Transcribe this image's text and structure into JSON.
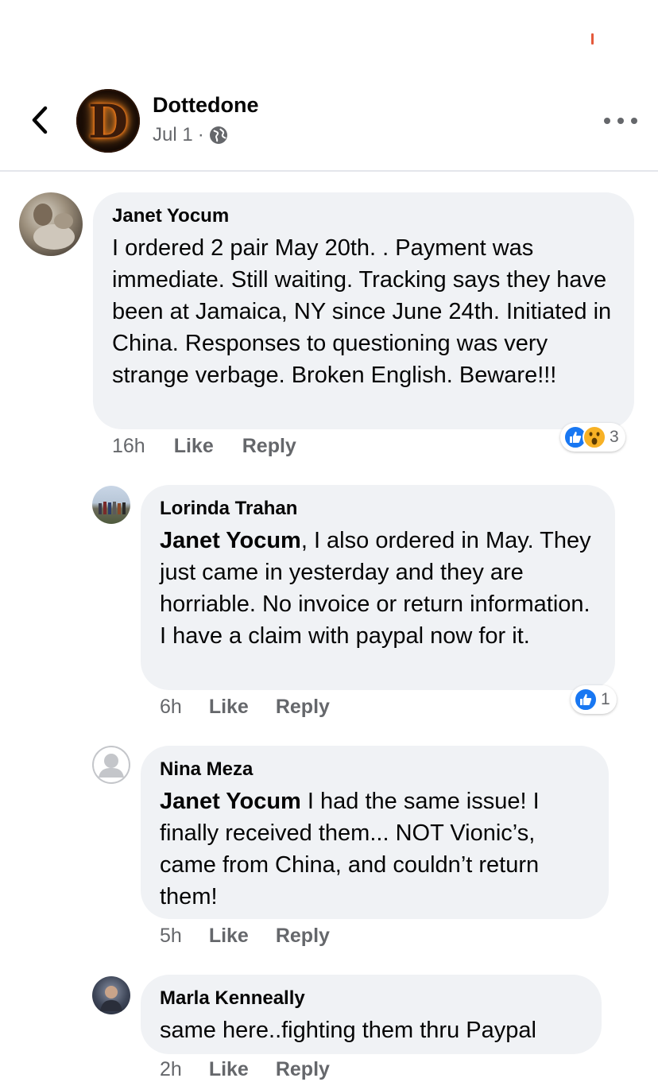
{
  "post": {
    "page_name": "Dottedone",
    "date": "Jul 1",
    "separator": "·",
    "avatar_letter": "D"
  },
  "icons": {
    "back": "chevron-left-icon",
    "more": "more-dots-icon",
    "privacy": "globe-icon",
    "like_reaction": "thumbs-up-icon",
    "wow_reaction": "wow-face-icon"
  },
  "colors": {
    "bubble": "#f0f2f5",
    "secondary_text": "#65676b",
    "like_blue": "#1877f2",
    "wow_yellow": "#f7b125"
  },
  "comments": [
    {
      "name": "Janet Yocum",
      "mention": "",
      "text": "I ordered 2 pair May 20th. . Payment was immediate.  Still waiting. Tracking says they have been at Jamaica, NY since June 24th. Initiated in China. Responses to questioning was very strange verbage. Broken English. Beware!!!",
      "time": "16h",
      "like_label": "Like",
      "reply_label": "Reply",
      "reaction_count": "3"
    },
    {
      "name": "Lorinda Trahan",
      "mention": "Janet Yocum",
      "text": ", I also ordered in May. They just came in yesterday  and they are horriable. No invoice or return information. I have a claim with paypal now for it.",
      "time": "6h",
      "like_label": "Like",
      "reply_label": "Reply",
      "reaction_count": "1"
    },
    {
      "name": "Nina Meza",
      "mention": "Janet Yocum",
      "text": " I had the same issue! I finally received them... NOT Vionic’s, came from China, and couldn’t return them!",
      "time": "5h",
      "like_label": "Like",
      "reply_label": "Reply"
    },
    {
      "name": "Marla Kenneally",
      "mention": "",
      "text": "same here..fighting them thru Paypal",
      "time": "2h",
      "like_label": "Like",
      "reply_label": "Reply"
    }
  ]
}
